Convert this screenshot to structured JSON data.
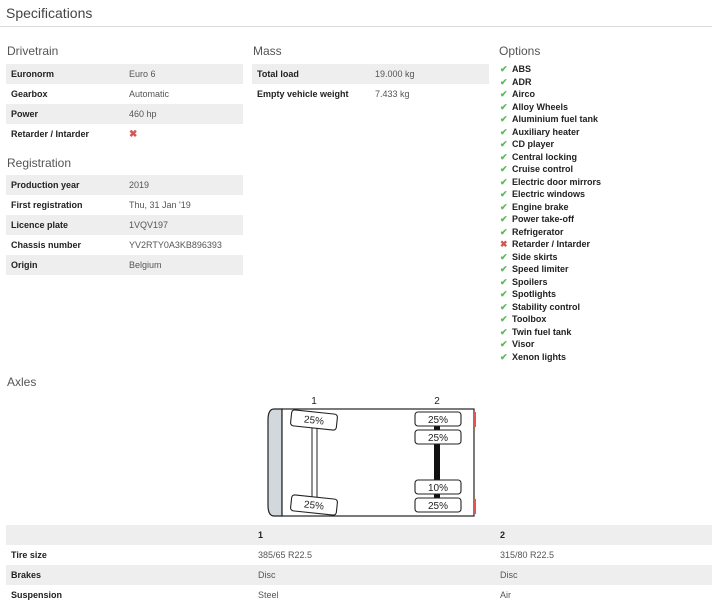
{
  "page_title": "Specifications",
  "drivetrain": {
    "title": "Drivetrain",
    "rows": [
      {
        "label": "Euronorm",
        "value": "Euro 6"
      },
      {
        "label": "Gearbox",
        "value": "Automatic"
      },
      {
        "label": "Power",
        "value": "460 hp"
      },
      {
        "label": "Retarder / Intarder",
        "value": "✖",
        "icon": "cross-icon"
      }
    ]
  },
  "registration": {
    "title": "Registration",
    "rows": [
      {
        "label": "Production year",
        "value": "2019"
      },
      {
        "label": "First registration",
        "value": "Thu, 31 Jan '19"
      },
      {
        "label": "Licence plate",
        "value": "1VQV197"
      },
      {
        "label": "Chassis number",
        "value": "YV2RTY0A3KB896393"
      },
      {
        "label": "Origin",
        "value": "Belgium"
      }
    ]
  },
  "mass": {
    "title": "Mass",
    "rows": [
      {
        "label": "Total load",
        "value": "19.000 kg"
      },
      {
        "label": "Empty vehicle weight",
        "value": "7.433 kg"
      }
    ]
  },
  "options": {
    "title": "Options",
    "items": [
      {
        "label": "ABS",
        "available": true
      },
      {
        "label": "ADR",
        "available": true
      },
      {
        "label": "Airco",
        "available": true
      },
      {
        "label": "Alloy Wheels",
        "available": true
      },
      {
        "label": "Aluminium fuel tank",
        "available": true
      },
      {
        "label": "Auxiliary heater",
        "available": true
      },
      {
        "label": "CD player",
        "available": true
      },
      {
        "label": "Central locking",
        "available": true
      },
      {
        "label": "Cruise control",
        "available": true
      },
      {
        "label": "Electric door mirrors",
        "available": true
      },
      {
        "label": "Electric windows",
        "available": true
      },
      {
        "label": "Engine brake",
        "available": true
      },
      {
        "label": "Power take-off",
        "available": true
      },
      {
        "label": "Refrigerator",
        "available": true
      },
      {
        "label": "Retarder / Intarder",
        "available": false
      },
      {
        "label": "Side skirts",
        "available": true
      },
      {
        "label": "Speed limiter",
        "available": true
      },
      {
        "label": "Spoilers",
        "available": true
      },
      {
        "label": "Spotlights",
        "available": true
      },
      {
        "label": "Stability control",
        "available": true
      },
      {
        "label": "Toolbox",
        "available": true
      },
      {
        "label": "Twin fuel tank",
        "available": true
      },
      {
        "label": "Visor",
        "available": true
      },
      {
        "label": "Xenon lights",
        "available": true
      }
    ],
    "check_glyph": "✔",
    "cross_glyph": "✖"
  },
  "axles": {
    "title": "Axles",
    "diagram": {
      "axle_labels": [
        "1",
        "2"
      ],
      "axle1_tires": [
        "25%",
        "25%"
      ],
      "axle2_tires": [
        "25%",
        "25%",
        "10%",
        "25%"
      ]
    },
    "table": {
      "headers": [
        "",
        "1",
        "2"
      ],
      "rows": [
        {
          "label": "Tire size",
          "values": [
            "385/65 R22.5",
            "315/80 R22.5"
          ]
        },
        {
          "label": "Brakes",
          "values": [
            "Disc",
            "Disc"
          ]
        },
        {
          "label": "Suspension",
          "values": [
            "Steel",
            "Air"
          ]
        }
      ]
    }
  },
  "colors": {
    "check": "#5cb85c",
    "cross": "#d9534f",
    "row_stripe": "#eeeeee",
    "cab": "#d3d8dc",
    "rear_light": "#e05555"
  }
}
